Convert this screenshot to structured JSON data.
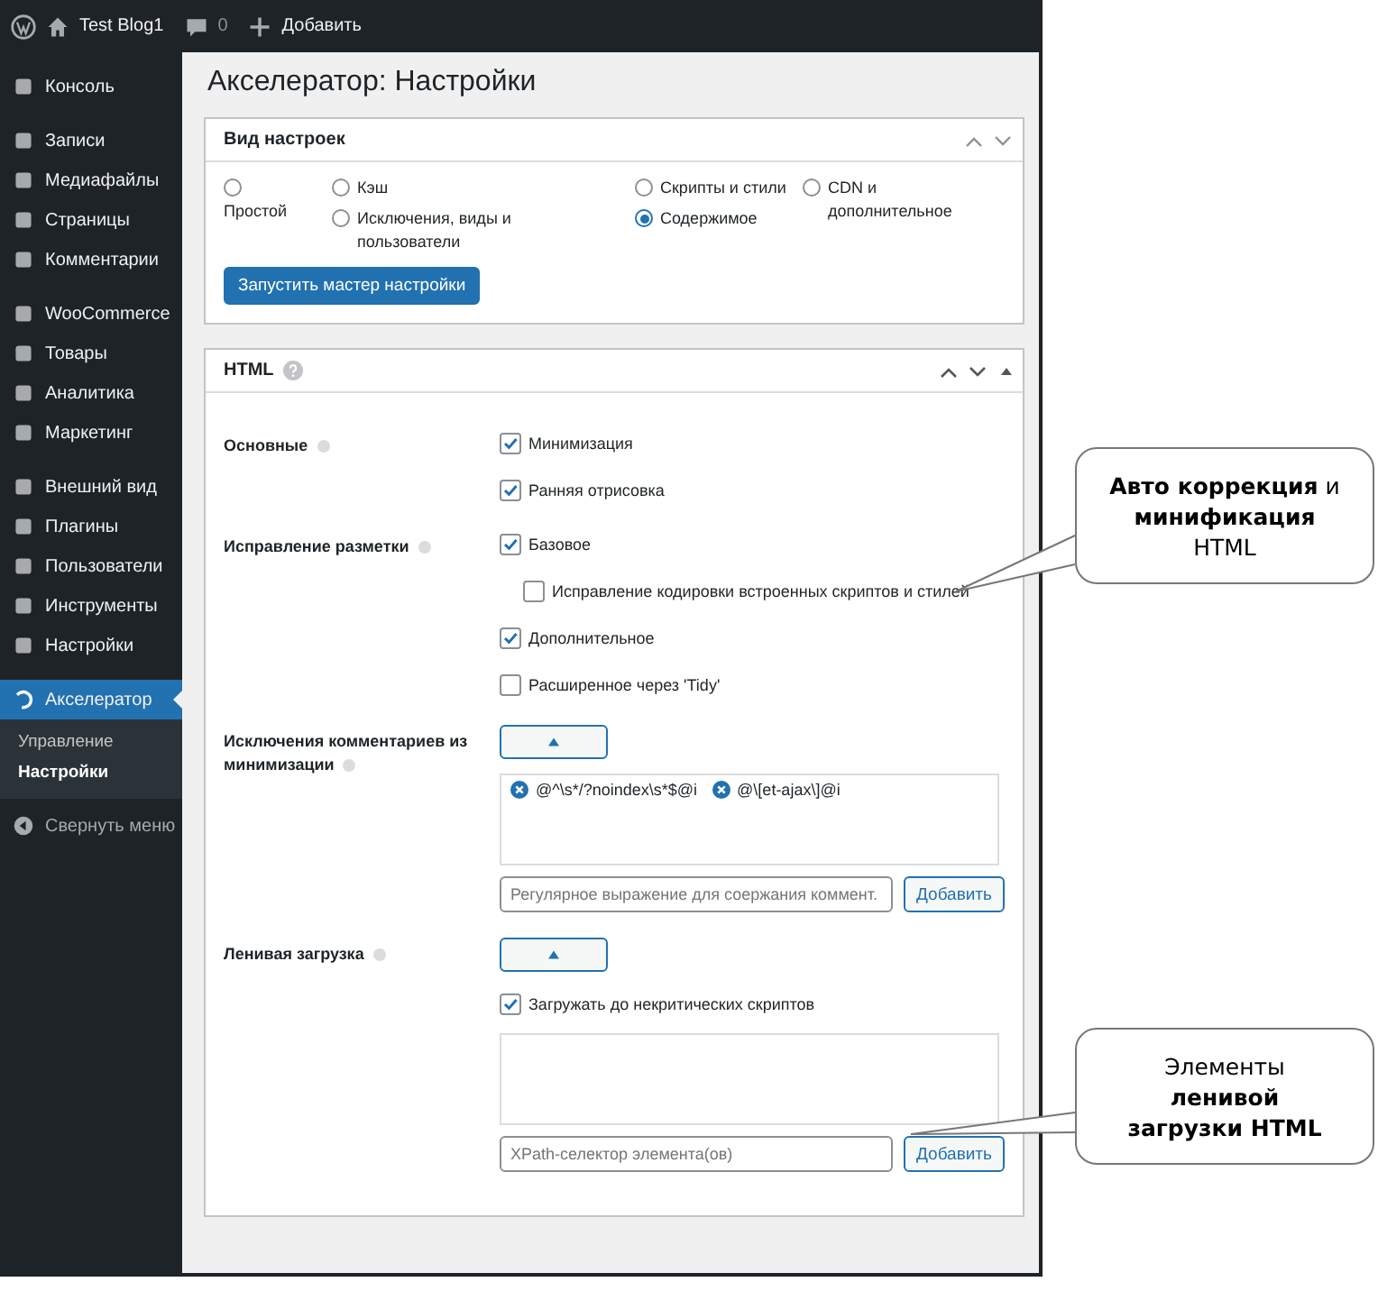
{
  "admin_bar": {
    "site_name": "Test Blog1",
    "comments": "0",
    "new_label": "Добавить"
  },
  "sidebar": {
    "groups": [
      [
        {
          "label": "Консоль",
          "selected": false
        }
      ],
      [
        {
          "label": "Записи",
          "selected": false
        },
        {
          "label": "Медиафайлы",
          "selected": false
        },
        {
          "label": "Страницы",
          "selected": false
        },
        {
          "label": "Комментарии",
          "selected": false
        }
      ],
      [
        {
          "label": "WooCommerce",
          "selected": false
        },
        {
          "label": "Товары",
          "selected": false
        },
        {
          "label": "Аналитика",
          "selected": false
        },
        {
          "label": "Маркетинг",
          "selected": false
        }
      ],
      [
        {
          "label": "Внешний вид",
          "selected": false
        },
        {
          "label": "Плагины",
          "selected": false
        },
        {
          "label": "Пользователи",
          "selected": false
        },
        {
          "label": "Инструменты",
          "selected": false
        },
        {
          "label": "Настройки",
          "selected": false
        }
      ],
      [
        {
          "label": "Акселератор",
          "selected": true
        }
      ]
    ],
    "submenu": [
      {
        "label": "Управление",
        "selected": false
      },
      {
        "label": "Настройки",
        "selected": true
      }
    ],
    "collapse": "Свернуть меню"
  },
  "page_title": "Акселератор: Настройки",
  "view_panel": {
    "title": "Вид настроек",
    "radio_columns": [
      [
        {
          "label": "Простой",
          "selected": false
        }
      ],
      [
        {
          "label": "Кэш",
          "selected": false
        },
        {
          "label": "Исключения, виды и пользователи",
          "selected": false
        }
      ],
      [
        {
          "label": "Скрипты и стили",
          "selected": false
        },
        {
          "label": "Содержимое",
          "selected": true
        }
      ],
      [
        {
          "label": "CDN и дополнительное",
          "selected": false
        }
      ]
    ],
    "button": "Запустить мастер настройки"
  },
  "html_panel": {
    "title": "HTML",
    "sections": [
      {
        "label": "Основные",
        "controls": [
          {
            "kind": "checkbox",
            "label": "Минимизация",
            "checked": true
          },
          {
            "kind": "checkbox",
            "label": "Ранняя отрисовка",
            "checked": true
          }
        ]
      },
      {
        "label": "Исправление разметки",
        "controls": [
          {
            "kind": "checkbox",
            "label": "Базовое",
            "checked": true
          },
          {
            "kind": "subcheckbox",
            "label": "Исправление кодировки встроенных скриптов и стилей",
            "checked": false
          },
          {
            "kind": "checkbox",
            "label": "Дополнительное",
            "checked": true
          },
          {
            "kind": "checkbox",
            "label": "Расширенное через 'Tidy'",
            "checked": false
          }
        ]
      },
      {
        "label": "Исключения комментариев из минимизации",
        "controls": [
          {
            "kind": "toggle"
          },
          {
            "kind": "tags",
            "tags": [
              "@^\\s*/?noindex\\s*$@i",
              "@\\[et-ajax\\]@i"
            ]
          },
          {
            "kind": "input",
            "placeholder": "Регулярное выражение для соержания коммент.",
            "button": "Добавить"
          }
        ]
      },
      {
        "label": "Ленивая загрузка",
        "controls": [
          {
            "kind": "toggle"
          },
          {
            "kind": "checkbox",
            "label": "Загружать до некритических скриптов",
            "checked": true
          },
          {
            "kind": "textarea"
          },
          {
            "kind": "input",
            "placeholder": "XPath-селектор элемента(ов)",
            "button": "Добавить"
          }
        ]
      }
    ]
  },
  "callouts": [
    {
      "text": "**Авто коррекция** и **минификация** HTML"
    },
    {
      "text": "Элементы **ленивой загрузки HTML**"
    }
  ]
}
